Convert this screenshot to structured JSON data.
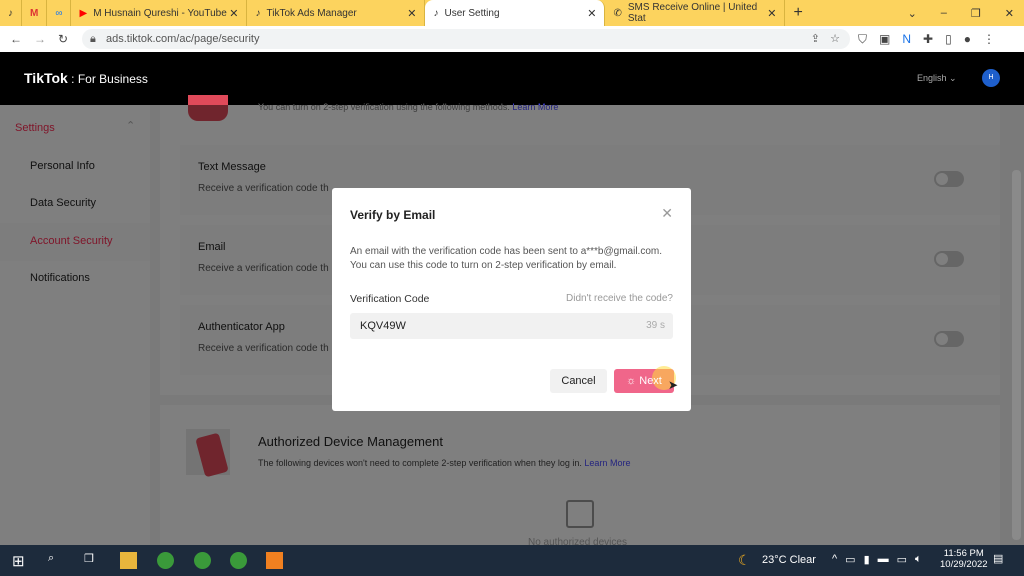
{
  "browser": {
    "tabs": [
      {
        "label": "",
        "icon": "tiktok-icon"
      },
      {
        "label": "",
        "icon": "gmail-icon"
      },
      {
        "label": "",
        "icon": "meta-icon"
      },
      {
        "label": "M Husnain Qureshi - YouTube",
        "icon": "youtube-icon"
      },
      {
        "label": "TikTok Ads Manager",
        "icon": "tiktok-icon"
      },
      {
        "label": "User Setting",
        "icon": "tiktok-icon",
        "active": true
      },
      {
        "label": "SMS Receive Online | United Stat",
        "icon": "phone-icon"
      }
    ],
    "url": "ads.tiktok.com/ac/page/security"
  },
  "header": {
    "logo": "TikTok",
    "logo_sub": "For Business",
    "language": "English",
    "avatar": "H"
  },
  "sidebar": {
    "section": "Settings",
    "items": [
      "Personal Info",
      "Data Security",
      "Account Security",
      "Notifications"
    ],
    "active": "Account Security"
  },
  "main": {
    "intro": "You can turn on 2-step verification using the following methods.",
    "intro_link": "Learn More",
    "methods": [
      {
        "title": "Text Message",
        "desc": "Receive a verification code th"
      },
      {
        "title": "Email",
        "desc": "Receive a verification code th"
      },
      {
        "title": "Authenticator App",
        "desc": "Receive a verification code th"
      }
    ],
    "devices": {
      "title": "Authorized Device Management",
      "desc": "The following devices won't need to complete 2-step verification when they log in.",
      "link": "Learn More",
      "empty": "No authorized devices"
    }
  },
  "modal": {
    "title": "Verify by Email",
    "message": "An email with the verification code has been sent to a***b@gmail.com. You can use this code to turn on 2-step verification by email.",
    "code_label": "Verification Code",
    "resend": "Didn't receive the code?",
    "code_value": "KQV49W",
    "countdown": "39 s",
    "cancel": "Cancel",
    "next": "Next"
  },
  "taskbar": {
    "weather": "23°C  Clear",
    "time": "11:56 PM",
    "date": "10/29/2022"
  },
  "colors": {
    "accent": "#fe2c55",
    "primary_button": "#f0668a",
    "link": "#4a4aff"
  }
}
